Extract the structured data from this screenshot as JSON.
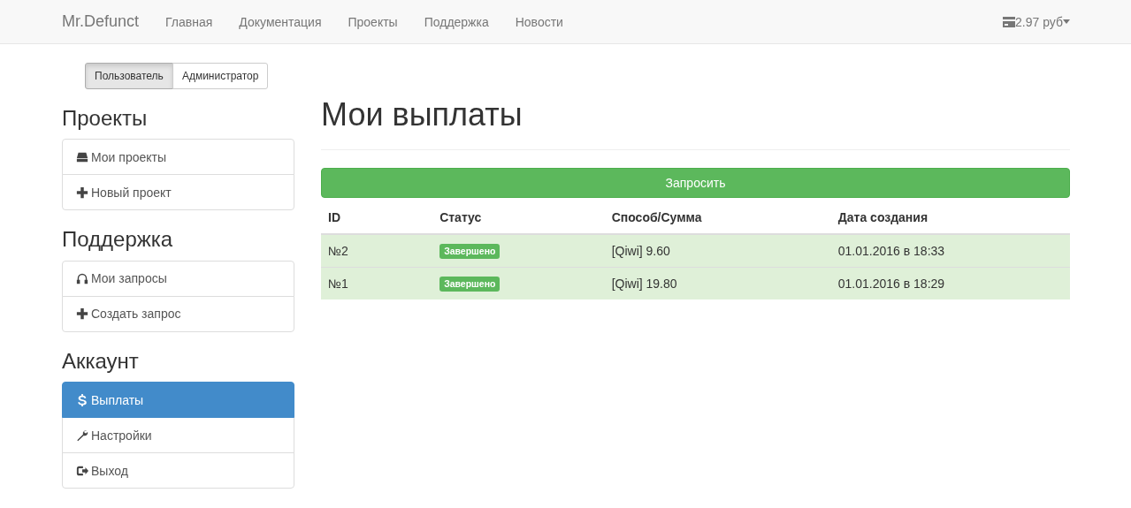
{
  "navbar": {
    "brand": "Mr.Defunct",
    "links": [
      {
        "label": "Главная"
      },
      {
        "label": "Документация"
      },
      {
        "label": "Проекты"
      },
      {
        "label": "Поддержка"
      },
      {
        "label": "Новости"
      }
    ],
    "balance": "2.97 руб"
  },
  "role_toggle": [
    {
      "label": "Пользователь",
      "selected": true
    },
    {
      "label": "Администратор",
      "selected": false
    }
  ],
  "sidebar": [
    {
      "heading": "Проекты",
      "items": [
        {
          "label": "Мои проекты",
          "kind": "hdd",
          "selected": false
        },
        {
          "label": "Новый проект",
          "kind": "plus",
          "selected": false
        }
      ]
    },
    {
      "heading": "Поддержка",
      "items": [
        {
          "label": "Мои запросы",
          "kind": "headphones",
          "selected": false
        },
        {
          "label": "Создать запрос",
          "kind": "plus",
          "selected": false
        }
      ]
    },
    {
      "heading": "Аккаунт",
      "items": [
        {
          "label": "Выплаты",
          "kind": "dollar",
          "selected": true
        },
        {
          "label": "Настройки",
          "kind": "wrench",
          "selected": false
        },
        {
          "label": "Выход",
          "kind": "logout",
          "selected": false
        }
      ]
    }
  ],
  "page_title": "Мои выплаты",
  "request_button": "Запросить",
  "table": {
    "columns": [
      "ID",
      "Статус",
      "Способ/Сумма",
      "Дата создания"
    ],
    "rows": [
      {
        "id": "№2",
        "status": "Завершено",
        "color": "#5cb85c",
        "amount": "[Qiwi] 9.60",
        "created": "01.01.2016 в 18:33"
      },
      {
        "id": "№1",
        "status": "Завершено",
        "color": "#5cb85c",
        "amount": "[Qiwi] 19.80",
        "created": "01.01.2016 в 18:29"
      }
    ]
  }
}
